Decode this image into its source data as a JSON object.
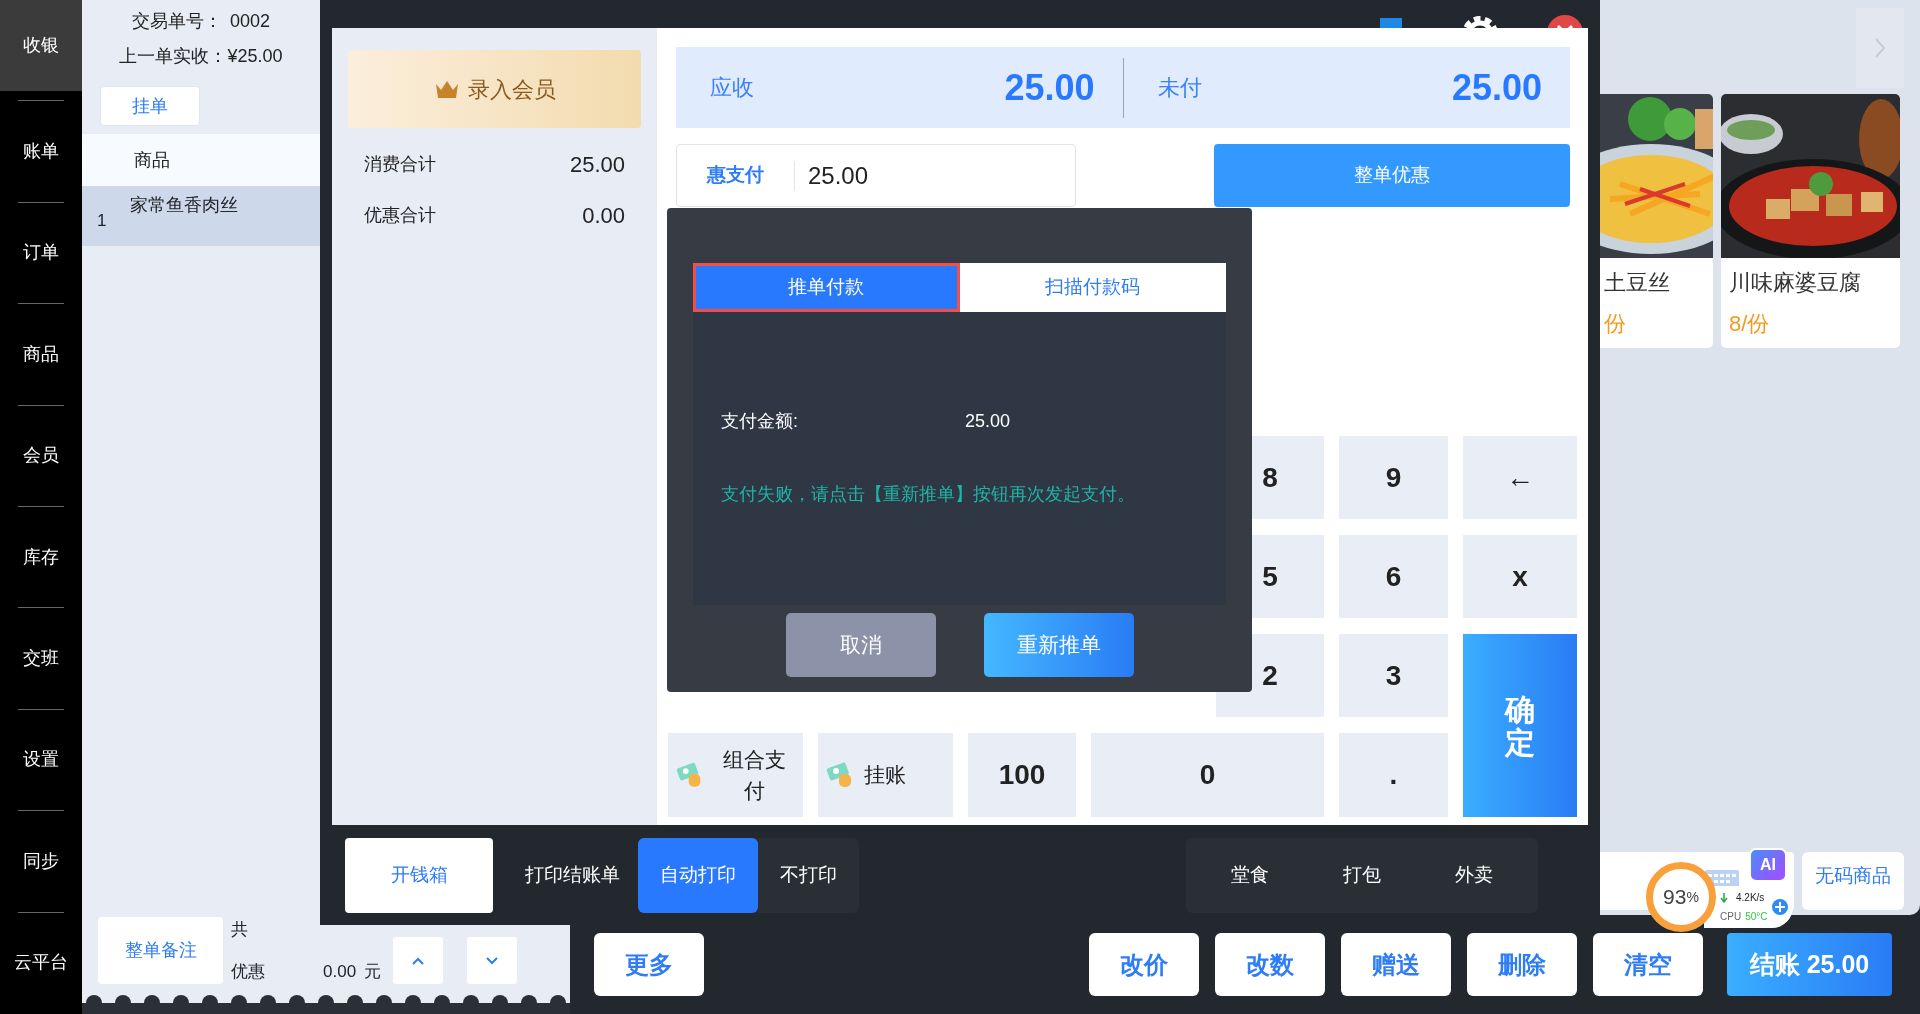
{
  "sidebar": {
    "items": [
      {
        "label": "收银",
        "selected": true
      },
      {
        "label": "账单",
        "selected": false
      },
      {
        "label": "订单",
        "selected": false
      },
      {
        "label": "商品",
        "selected": false
      },
      {
        "label": "会员",
        "selected": false
      },
      {
        "label": "库存",
        "selected": false
      },
      {
        "label": "交班",
        "selected": false
      },
      {
        "label": "设置",
        "selected": false
      },
      {
        "label": "同步",
        "selected": false
      },
      {
        "label": "云平台",
        "selected": false
      }
    ]
  },
  "order_panel": {
    "trade_no_label": "交易单号：",
    "trade_no": "0002",
    "last_paid_label": "上一单实收：",
    "last_paid": "¥25.00",
    "hold_button": "挂单",
    "table": {
      "columns": [
        "商品"
      ],
      "rows": [
        {
          "index": "1",
          "name": "家常鱼香肉丝",
          "selected": true
        }
      ]
    },
    "remark_button": "整单备注",
    "total_label": "共",
    "discount_label": "优惠",
    "discount": "0.00",
    "discount_unit": "元"
  },
  "products": [
    {
      "name": "土豆丝",
      "price": "份"
    },
    {
      "name": "川味麻婆豆腐",
      "price": "8/份"
    }
  ],
  "no_code_button": "无码商品",
  "toolbar": {
    "more": "更多",
    "actions": [
      "改价",
      "改数",
      "赠送",
      "删除",
      "清空"
    ],
    "checkout": "结账 25.00"
  },
  "monitor": {
    "percent": "93",
    "percent_sign": "%",
    "speed": "4.2K/s",
    "cpu_label": "CPU",
    "temperature": "50°C",
    "ai_badge": "AI"
  },
  "checkout": {
    "member_button": "录入会员",
    "totals": [
      {
        "label": "消费合计",
        "value": "25.00"
      },
      {
        "label": "优惠合计",
        "value": "0.00"
      }
    ],
    "due": {
      "label": "应收",
      "value": "25.00"
    },
    "unpaid": {
      "label": "未付",
      "value": "25.00"
    },
    "payment_field": {
      "method": "惠支付",
      "value": "25.00"
    },
    "discount_button": "整单优惠",
    "keypad": [
      {
        "label": "8",
        "kind": "digit"
      },
      {
        "label": "9",
        "kind": "digit"
      },
      {
        "label": "←",
        "kind": "digit"
      },
      {
        "label": "5",
        "kind": "digit"
      },
      {
        "label": "6",
        "kind": "digit"
      },
      {
        "label": "x",
        "kind": "digit"
      },
      {
        "label": "2",
        "kind": "digit"
      },
      {
        "label": "3",
        "kind": "digit"
      },
      {
        "label": "确定",
        "kind": "confirm"
      },
      {
        "label": "组合支付",
        "kind": "pay"
      },
      {
        "label": "挂账",
        "kind": "pay"
      },
      {
        "label": "100",
        "kind": "digit"
      },
      {
        "label": "0",
        "kind": "digit"
      },
      {
        "label": ".",
        "kind": "digit"
      }
    ],
    "cash_drawer_button": "开钱箱",
    "print_label": "打印结账单",
    "print_options": [
      {
        "label": "自动打印",
        "selected": true
      },
      {
        "label": "不打印",
        "selected": false
      }
    ],
    "order_types": [
      "堂食",
      "打包",
      "外卖"
    ]
  },
  "dialog": {
    "tabs": [
      {
        "label": "推单付款",
        "selected": true
      },
      {
        "label": "扫描付款码",
        "selected": false
      }
    ],
    "amount_label": "支付金额:",
    "amount": "25.00",
    "message": "支付失败，请点击【重新推单】按钮再次发起支付。",
    "buttons": [
      {
        "label": "取消",
        "kind": "secondary"
      },
      {
        "label": "重新推单",
        "kind": "primary"
      }
    ]
  }
}
